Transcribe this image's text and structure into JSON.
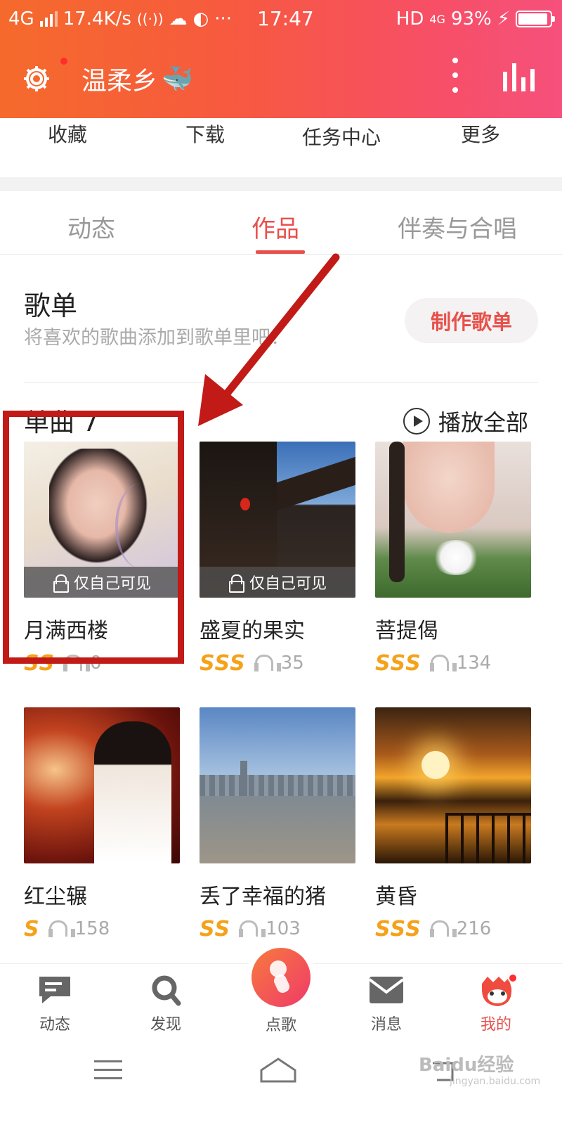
{
  "status": {
    "network": "4G",
    "speed": "17.4K/s",
    "time": "17:47",
    "hd": "HD",
    "hd_4g": "4G",
    "battery": "93%",
    "battery_level": 0.93
  },
  "header": {
    "username": "温柔乡",
    "accent": "#f75a3e"
  },
  "quick_menu": [
    "收藏",
    "下载",
    "任务中心",
    "更多"
  ],
  "tabs": [
    "动态",
    "作品",
    "伴奏与合唱"
  ],
  "playlist": {
    "title": "歌单",
    "subtitle": "将喜欢的歌曲添加到歌单里吧！",
    "button": "制作歌单"
  },
  "singles": {
    "title": "单曲 7",
    "play_all": "播放全部",
    "private_label": "仅自己可见",
    "songs": [
      {
        "name": "月满西楼",
        "grade": "SS",
        "plays": "0",
        "private": true
      },
      {
        "name": "盛夏的果实",
        "grade": "SSS",
        "plays": "35",
        "private": true
      },
      {
        "name": "菩提偈",
        "grade": "SSS",
        "plays": "134",
        "private": false
      },
      {
        "name": "红尘辗",
        "grade": "S",
        "plays": "158",
        "private": false
      },
      {
        "name": "丢了幸福的猪",
        "grade": "SS",
        "plays": "103",
        "private": false
      },
      {
        "name": "黄昏",
        "grade": "SSS",
        "plays": "216",
        "private": false
      }
    ]
  },
  "bottom_nav": [
    "动态",
    "发现",
    "点歌",
    "消息",
    "我的"
  ],
  "watermark": "Baidu经验",
  "watermark_sub": "jingyan.baidu.com"
}
